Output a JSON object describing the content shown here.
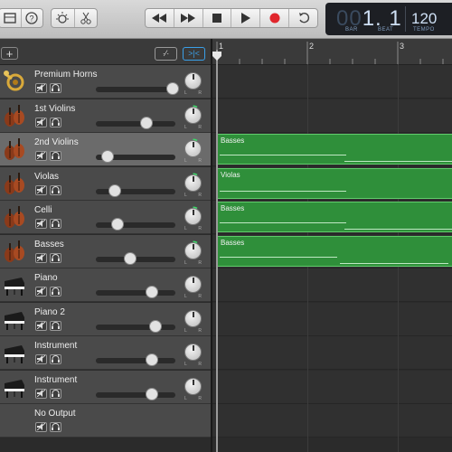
{
  "toolbar": {
    "library_icon": "library-icon",
    "help_icon": "help-icon",
    "smart_controls_icon": "smart-controls-icon",
    "editors_icon": "scissors-icon",
    "transport": [
      "rewind-icon",
      "fast-forward-icon",
      "stop-icon",
      "play-icon",
      "record-icon",
      "cycle-icon"
    ],
    "record_color": "#e0262c"
  },
  "lcd": {
    "position_dim": "00",
    "position": "1. 1",
    "bar_label": "BAR",
    "beat_label": "BEAT",
    "tempo": "120",
    "tempo_label": "TEMPO"
  },
  "header": {
    "add_track_label": "+",
    "automation_label": "·⁄·",
    "catch_label": ">|<",
    "catch_color": "#3aa0e8"
  },
  "ruler": {
    "bars": [
      "1",
      "2",
      "3"
    ]
  },
  "tracks": [
    {
      "name": "Premium Horns",
      "icon": "horn-icon",
      "volume": 0.97,
      "selected": false,
      "pan_active": false
    },
    {
      "name": "1st Violins",
      "icon": "violin-icon",
      "volume": 0.64,
      "selected": false,
      "pan_active": true
    },
    {
      "name": "2nd Violins",
      "icon": "violin-icon",
      "volume": 0.15,
      "selected": true,
      "pan_active": true
    },
    {
      "name": "Violas",
      "icon": "violin-icon",
      "volume": 0.24,
      "selected": false,
      "pan_active": true
    },
    {
      "name": "Celli",
      "icon": "violin-icon",
      "volume": 0.27,
      "selected": false,
      "pan_active": true
    },
    {
      "name": "Basses",
      "icon": "violin-icon",
      "volume": 0.43,
      "selected": false,
      "pan_active": true
    },
    {
      "name": "Piano",
      "icon": "piano-icon",
      "volume": 0.71,
      "selected": false,
      "pan_active": false
    },
    {
      "name": "Piano 2",
      "icon": "piano-icon",
      "volume": 0.75,
      "selected": false,
      "pan_active": false
    },
    {
      "name": "Instrument",
      "icon": "piano-icon",
      "volume": 0.71,
      "selected": false,
      "pan_active": false
    },
    {
      "name": "Instrument",
      "icon": "piano-icon",
      "volume": 0.71,
      "selected": false,
      "pan_active": false
    },
    {
      "name": "No Output",
      "icon": "",
      "volume": null,
      "selected": false,
      "pan_active": false
    }
  ],
  "regions": [
    {
      "track": 2,
      "name": "Basses"
    },
    {
      "track": 3,
      "name": "Violas"
    },
    {
      "track": 4,
      "name": "Basses"
    },
    {
      "track": 5,
      "name": "Basses"
    }
  ],
  "colors": {
    "region": "#2f8f3a",
    "region_border": "#5fcc6a",
    "pan_active": "#3ddc6a"
  }
}
